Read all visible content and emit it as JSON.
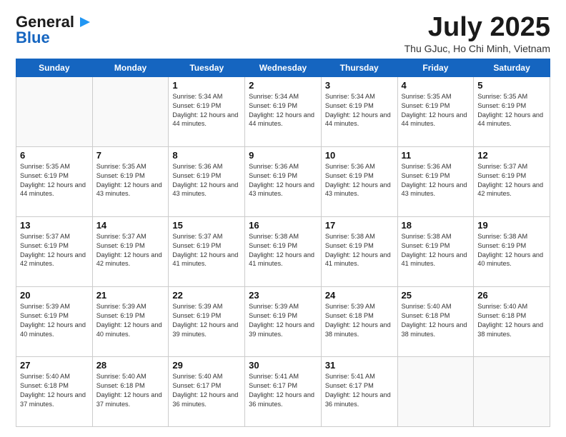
{
  "logo": {
    "line1": "General",
    "line2": "Blue"
  },
  "title": "July 2025",
  "subtitle": "Thu GJuc, Ho Chi Minh, Vietnam",
  "days_of_week": [
    "Sunday",
    "Monday",
    "Tuesday",
    "Wednesday",
    "Thursday",
    "Friday",
    "Saturday"
  ],
  "weeks": [
    [
      {
        "day": "",
        "info": ""
      },
      {
        "day": "",
        "info": ""
      },
      {
        "day": "1",
        "info": "Sunrise: 5:34 AM\nSunset: 6:19 PM\nDaylight: 12 hours and 44 minutes."
      },
      {
        "day": "2",
        "info": "Sunrise: 5:34 AM\nSunset: 6:19 PM\nDaylight: 12 hours and 44 minutes."
      },
      {
        "day": "3",
        "info": "Sunrise: 5:34 AM\nSunset: 6:19 PM\nDaylight: 12 hours and 44 minutes."
      },
      {
        "day": "4",
        "info": "Sunrise: 5:35 AM\nSunset: 6:19 PM\nDaylight: 12 hours and 44 minutes."
      },
      {
        "day": "5",
        "info": "Sunrise: 5:35 AM\nSunset: 6:19 PM\nDaylight: 12 hours and 44 minutes."
      }
    ],
    [
      {
        "day": "6",
        "info": "Sunrise: 5:35 AM\nSunset: 6:19 PM\nDaylight: 12 hours and 44 minutes."
      },
      {
        "day": "7",
        "info": "Sunrise: 5:35 AM\nSunset: 6:19 PM\nDaylight: 12 hours and 43 minutes."
      },
      {
        "day": "8",
        "info": "Sunrise: 5:36 AM\nSunset: 6:19 PM\nDaylight: 12 hours and 43 minutes."
      },
      {
        "day": "9",
        "info": "Sunrise: 5:36 AM\nSunset: 6:19 PM\nDaylight: 12 hours and 43 minutes."
      },
      {
        "day": "10",
        "info": "Sunrise: 5:36 AM\nSunset: 6:19 PM\nDaylight: 12 hours and 43 minutes."
      },
      {
        "day": "11",
        "info": "Sunrise: 5:36 AM\nSunset: 6:19 PM\nDaylight: 12 hours and 43 minutes."
      },
      {
        "day": "12",
        "info": "Sunrise: 5:37 AM\nSunset: 6:19 PM\nDaylight: 12 hours and 42 minutes."
      }
    ],
    [
      {
        "day": "13",
        "info": "Sunrise: 5:37 AM\nSunset: 6:19 PM\nDaylight: 12 hours and 42 minutes."
      },
      {
        "day": "14",
        "info": "Sunrise: 5:37 AM\nSunset: 6:19 PM\nDaylight: 12 hours and 42 minutes."
      },
      {
        "day": "15",
        "info": "Sunrise: 5:37 AM\nSunset: 6:19 PM\nDaylight: 12 hours and 41 minutes."
      },
      {
        "day": "16",
        "info": "Sunrise: 5:38 AM\nSunset: 6:19 PM\nDaylight: 12 hours and 41 minutes."
      },
      {
        "day": "17",
        "info": "Sunrise: 5:38 AM\nSunset: 6:19 PM\nDaylight: 12 hours and 41 minutes."
      },
      {
        "day": "18",
        "info": "Sunrise: 5:38 AM\nSunset: 6:19 PM\nDaylight: 12 hours and 41 minutes."
      },
      {
        "day": "19",
        "info": "Sunrise: 5:38 AM\nSunset: 6:19 PM\nDaylight: 12 hours and 40 minutes."
      }
    ],
    [
      {
        "day": "20",
        "info": "Sunrise: 5:39 AM\nSunset: 6:19 PM\nDaylight: 12 hours and 40 minutes."
      },
      {
        "day": "21",
        "info": "Sunrise: 5:39 AM\nSunset: 6:19 PM\nDaylight: 12 hours and 40 minutes."
      },
      {
        "day": "22",
        "info": "Sunrise: 5:39 AM\nSunset: 6:19 PM\nDaylight: 12 hours and 39 minutes."
      },
      {
        "day": "23",
        "info": "Sunrise: 5:39 AM\nSunset: 6:19 PM\nDaylight: 12 hours and 39 minutes."
      },
      {
        "day": "24",
        "info": "Sunrise: 5:39 AM\nSunset: 6:18 PM\nDaylight: 12 hours and 38 minutes."
      },
      {
        "day": "25",
        "info": "Sunrise: 5:40 AM\nSunset: 6:18 PM\nDaylight: 12 hours and 38 minutes."
      },
      {
        "day": "26",
        "info": "Sunrise: 5:40 AM\nSunset: 6:18 PM\nDaylight: 12 hours and 38 minutes."
      }
    ],
    [
      {
        "day": "27",
        "info": "Sunrise: 5:40 AM\nSunset: 6:18 PM\nDaylight: 12 hours and 37 minutes."
      },
      {
        "day": "28",
        "info": "Sunrise: 5:40 AM\nSunset: 6:18 PM\nDaylight: 12 hours and 37 minutes."
      },
      {
        "day": "29",
        "info": "Sunrise: 5:40 AM\nSunset: 6:17 PM\nDaylight: 12 hours and 36 minutes."
      },
      {
        "day": "30",
        "info": "Sunrise: 5:41 AM\nSunset: 6:17 PM\nDaylight: 12 hours and 36 minutes."
      },
      {
        "day": "31",
        "info": "Sunrise: 5:41 AM\nSunset: 6:17 PM\nDaylight: 12 hours and 36 minutes."
      },
      {
        "day": "",
        "info": ""
      },
      {
        "day": "",
        "info": ""
      }
    ]
  ]
}
